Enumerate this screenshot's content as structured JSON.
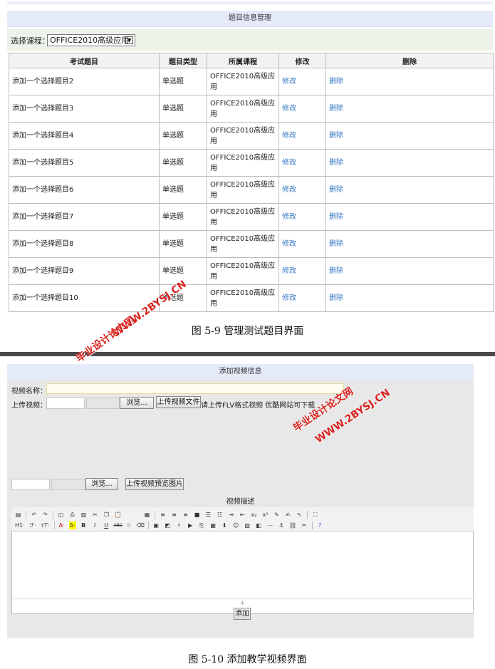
{
  "fig1": {
    "title": "题目信息管理",
    "filter_label": "选择课程：",
    "course_selected": "OFFICE2010高级应用",
    "headers": [
      "考试题目",
      "题目类型",
      "所属课程",
      "修改",
      "删除"
    ],
    "rows": [
      {
        "title": "添加一个选择题目2",
        "type": "单选题",
        "course": "OFFICE2010高级应用",
        "edit": "修改",
        "del": "删除"
      },
      {
        "title": "添加一个选择题目3",
        "type": "单选题",
        "course": "OFFICE2010高级应用",
        "edit": "修改",
        "del": "删除"
      },
      {
        "title": "添加一个选择题目4",
        "type": "单选题",
        "course": "OFFICE2010高级应用",
        "edit": "修改",
        "del": "删除"
      },
      {
        "title": "添加一个选择题目5",
        "type": "单选题",
        "course": "OFFICE2010高级应用",
        "edit": "修改",
        "del": "删除"
      },
      {
        "title": "添加一个选择题目6",
        "type": "单选题",
        "course": "OFFICE2010高级应用",
        "edit": "修改",
        "del": "删除"
      },
      {
        "title": "添加一个选择题目7",
        "type": "单选题",
        "course": "OFFICE2010高级应用",
        "edit": "修改",
        "del": "删除"
      },
      {
        "title": "添加一个选择题目8",
        "type": "单选题",
        "course": "OFFICE2010高级应用",
        "edit": "修改",
        "del": "删除"
      },
      {
        "title": "添加一个选择题目9",
        "type": "单选题",
        "course": "OFFICE2010高级应用",
        "edit": "修改",
        "del": "删除"
      },
      {
        "title": "添加一个选择题目10",
        "type": "单选题",
        "course": "OFFICE2010高级应用",
        "edit": "修改",
        "del": "删除"
      }
    ],
    "caption": "图 5-9 管理测试题目界面"
  },
  "fig2": {
    "title": "添加视频信息",
    "name_label": "视频名称：",
    "upload_label": "上传视频：",
    "browse": "浏览...",
    "upload_video_btn": "上传视频文件",
    "upload_hint": "请上传FLV格式视频 优酷网站可下载",
    "upload_preview_btn": "上传视频预览图片",
    "desc_label": "视频描述",
    "toolbar_text": {
      "h1": "H1·",
      "font": "ℱ·",
      "size": "тT·",
      "bold": "B",
      "italic": "I",
      "underline": "U",
      "strike": "ABC"
    },
    "submit_btn": "添加",
    "caption": "图 5-10 添加教学视频界面"
  },
  "watermark": {
    "cn": "毕业设计论文网",
    "url": "WWW.2BYSJ.CN"
  },
  "colors": {
    "link": "#3577c4",
    "watermark": "#d8231f",
    "header_bar": "#e4eaf8",
    "filter_bar": "#edf3e9"
  }
}
